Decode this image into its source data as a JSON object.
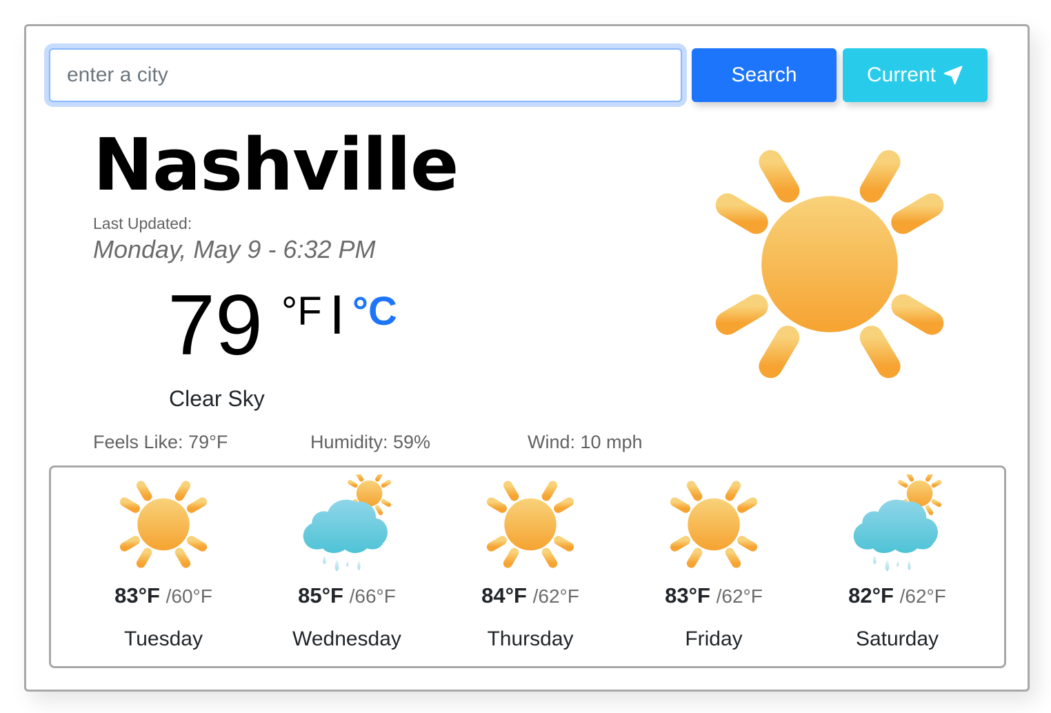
{
  "search": {
    "placeholder": "enter a city",
    "value": "",
    "search_label": "Search",
    "current_label": "Current",
    "current_icon": "location-arrow-icon"
  },
  "current": {
    "city": "Nashville",
    "updated_label": "Last Updated:",
    "updated_date": "Monday, May 9 - 6:32 PM",
    "temperature": "79",
    "unit_f": "°F",
    "unit_separator": "|",
    "unit_c": "°C",
    "description": "Clear Sky",
    "icon": "sun-icon",
    "feels_like": "Feels Like: 79°F",
    "humidity": "Humidity: 59%",
    "wind": "Wind: 10 mph"
  },
  "colors": {
    "search_button": "#1d75fb",
    "current_button": "#29cbeb",
    "celsius_link": "#1d75fb",
    "sun": "#f7b24a",
    "cloud": "#5ec6da"
  },
  "forecast": [
    {
      "day": "Tuesday",
      "max": "83°F",
      "min": "/60°F",
      "icon": "sun-icon"
    },
    {
      "day": "Wednesday",
      "max": "85°F",
      "min": "/66°F",
      "icon": "rain-cloud-sun-icon"
    },
    {
      "day": "Thursday",
      "max": "84°F",
      "min": "/62°F",
      "icon": "sun-icon"
    },
    {
      "day": "Friday",
      "max": "83°F",
      "min": "/62°F",
      "icon": "sun-icon"
    },
    {
      "day": "Saturday",
      "max": "82°F",
      "min": "/62°F",
      "icon": "rain-cloud-sun-icon"
    }
  ]
}
